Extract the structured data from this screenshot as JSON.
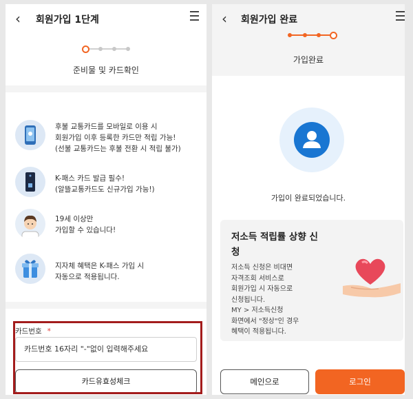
{
  "colors": {
    "accent": "#f26522",
    "primary_blue": "#1976d2",
    "highlight_frame": "#a31c1c",
    "required_mark": "#e53935"
  },
  "step1": {
    "title": "회원가입 1단계",
    "back_icon": "chevron-left-icon",
    "menu_icon": "hamburger-menu-icon",
    "step_label": "준비물 및 카드확인",
    "info_items": [
      {
        "icon": "phone-card-icon",
        "lines": [
          "후불 교통카드를 모바일로 이용 시",
          "회원가입 이후 등록한 카드만 적립 가능!",
          "(선불 교통카드는 후불 전환 시 적립 불가)"
        ]
      },
      {
        "icon": "k-pass-card-icon",
        "lines": [
          "K-패스 카드 발급 필수!",
          "(알뜰교통카드도 신규가입 가능!)"
        ]
      },
      {
        "icon": "person-avatar-icon",
        "lines": [
          "19세 이상만",
          "가입할 수 있습니다!"
        ]
      },
      {
        "icon": "gift-icon",
        "lines": [
          "지자체 혜택은 K-패스 가입 시",
          "자동으로 적용됩니다."
        ]
      }
    ],
    "card_number_label": "카드번호",
    "required_mark": "*",
    "card_number_placeholder": "카드번호 16자리 \"-\"없이 입력해주세요",
    "check_button": "카드유효성체크"
  },
  "complete": {
    "title": "회원가입 완료",
    "back_icon": "chevron-left-icon",
    "menu_icon": "hamburger-menu-icon",
    "step_label": "가입완료",
    "complete_icon": "user-check-icon",
    "message": "가입이 완료되었습니다.",
    "promo": {
      "title": "저소득 적립률 상향 신청",
      "lines": [
        "저소득 신청은 비대면",
        "자격조회 서비스로",
        "회원가입 시 자동으로",
        "신청됩니다.",
        "MY > 저소득신청",
        "화면에서 \"정상\"인 경우",
        "혜택이 적용됩니다."
      ],
      "image_icon": "heart-in-hand-icon"
    },
    "main_button": "메인으로",
    "login_button": "로그인"
  }
}
